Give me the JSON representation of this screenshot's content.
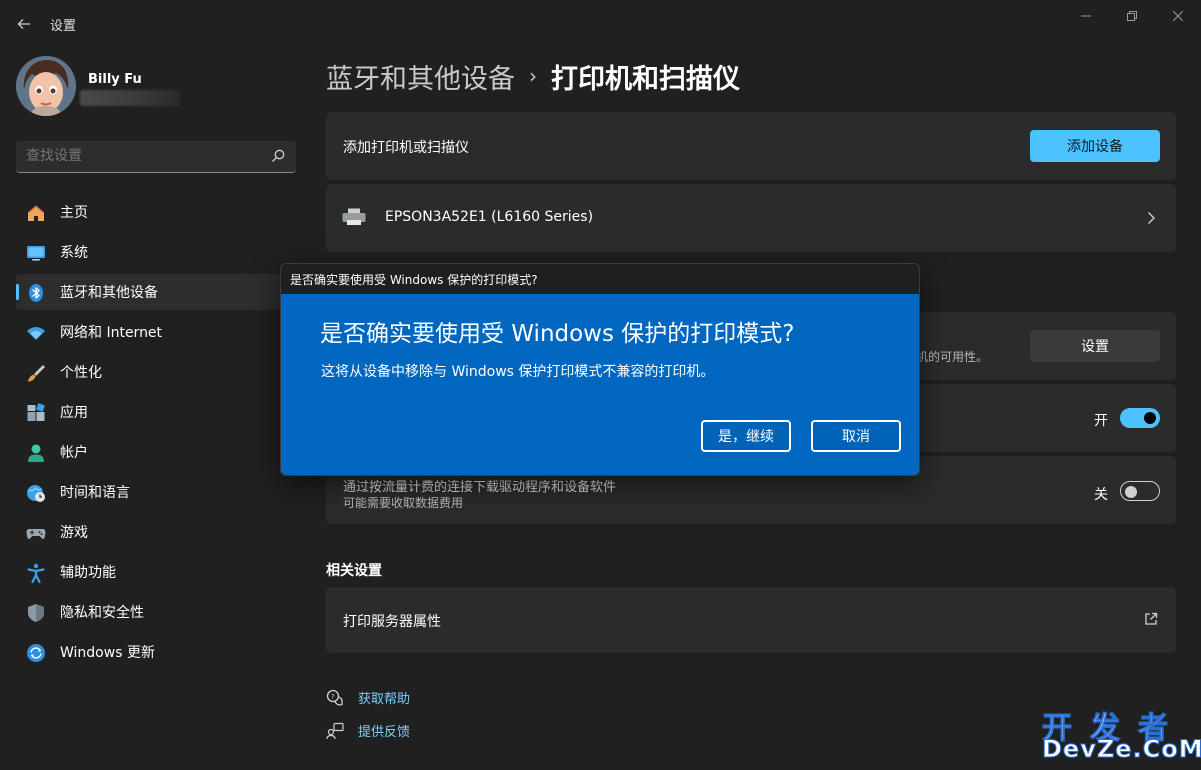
{
  "window": {
    "app_title": "设置",
    "back_icon": "arrow-left-icon"
  },
  "profile": {
    "name": "Billy Fu"
  },
  "search": {
    "placeholder": "查找设置"
  },
  "sidebar": {
    "items": [
      {
        "label": "主页",
        "icon": "home-icon"
      },
      {
        "label": "系统",
        "icon": "monitor-icon"
      },
      {
        "label": "蓝牙和其他设备",
        "icon": "bluetooth-icon",
        "active": true
      },
      {
        "label": "网络和 Internet",
        "icon": "wifi-icon"
      },
      {
        "label": "个性化",
        "icon": "brush-icon"
      },
      {
        "label": "应用",
        "icon": "apps-icon"
      },
      {
        "label": "帐户",
        "icon": "account-icon"
      },
      {
        "label": "时间和语言",
        "icon": "globe-clock-icon"
      },
      {
        "label": "游戏",
        "icon": "gamepad-icon"
      },
      {
        "label": "辅助功能",
        "icon": "accessibility-icon"
      },
      {
        "label": "隐私和安全性",
        "icon": "shield-icon"
      },
      {
        "label": "Windows 更新",
        "icon": "update-icon"
      }
    ]
  },
  "breadcrumb": {
    "parent": "蓝牙和其他设备",
    "separator": "›",
    "current": "打印机和扫描仪"
  },
  "main": {
    "add_printer": {
      "label": "添加打印机或扫描仪",
      "button": "添加设备"
    },
    "printer": {
      "name": "EPSON3A52E1 (L6160 Series)"
    },
    "protected_mode": {
      "partial_text": "机的可用性。",
      "button": "设置"
    },
    "toggle_on": {
      "state_label": "开"
    },
    "metered": {
      "title": "通过按流量计费的连接下载驱动程序和设备软件",
      "subtitle": "可能需要收取数据费用",
      "state_label": "关"
    },
    "related_title": "相关设置",
    "print_server": {
      "label": "打印服务器属性"
    },
    "help": {
      "get_help": "获取帮助",
      "feedback": "提供反馈"
    }
  },
  "dialog": {
    "title": "是否确实要使用受 Windows 保护的打印模式?",
    "heading": "是否确实要使用受 Windows 保护的打印模式?",
    "message": "这将从设备中移除与 Windows 保护打印模式不兼容的打印机。",
    "yes_button": "是，继续",
    "cancel_button": "取消"
  },
  "watermark": {
    "line1": "开发者",
    "line2": "DevZe.CoM"
  },
  "colors": {
    "background": "#202020",
    "card": "#2b2b2b",
    "accent": "#4cc2ff",
    "dialog_blue": "#0067c0",
    "link": "#7dcfff"
  }
}
